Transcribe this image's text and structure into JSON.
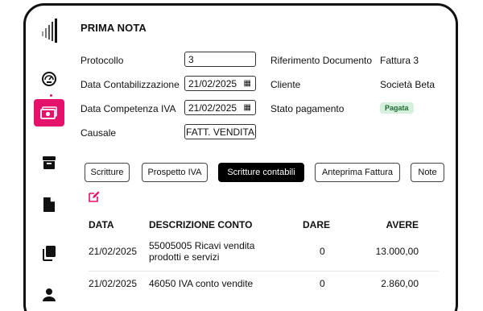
{
  "page": {
    "title": "PRIMA NOTA"
  },
  "sidebar": {
    "items": [
      {
        "icon": "dashboard-gauge-icon",
        "active": false
      },
      {
        "icon": "cash-icon",
        "active": true
      },
      {
        "icon": "archive-icon",
        "active": false
      },
      {
        "icon": "document-icon",
        "active": false
      },
      {
        "icon": "copy-icon",
        "active": false
      },
      {
        "icon": "user-icon",
        "active": false
      }
    ]
  },
  "form": {
    "protocollo": {
      "label": "Protocollo",
      "value": "3"
    },
    "data_contabilizzazione": {
      "label": "Data Contabilizzazione",
      "value": "21/02/2025"
    },
    "data_competenza_iva": {
      "label": "Data Competenza IVA",
      "value": "21/02/2025"
    },
    "causale": {
      "label": "Causale",
      "value": "FATT. VENDITA"
    },
    "riferimento_documento": {
      "label": "Riferimento Documento",
      "value": "Fattura 3"
    },
    "cliente": {
      "label": "Cliente",
      "value": "Società Beta"
    },
    "stato_pagamento": {
      "label": "Stato pagamento",
      "value": "Pagata"
    }
  },
  "tabs": [
    {
      "label": "Scritture",
      "active": false
    },
    {
      "label": "Prospetto IVA",
      "active": false
    },
    {
      "label": "Scritture contabili",
      "active": true
    },
    {
      "label": "Anteprima Fattura",
      "active": false
    },
    {
      "label": "Note",
      "active": false
    }
  ],
  "table": {
    "headers": {
      "data": "DATA",
      "descrizione": "DESCRIZIONE CONTO",
      "dare": "DARE",
      "avere": "AVERE"
    },
    "rows": [
      {
        "data": "21/02/2025",
        "descrizione": "55005005 Ricavi vendita prodotti e servizi",
        "dare": "0",
        "avere": "13.000,00"
      },
      {
        "data": "21/02/2025",
        "descrizione": "46050 IVA conto vendite",
        "dare": "0",
        "avere": "2.860,00"
      }
    ]
  },
  "colors": {
    "accent": "#e4126b",
    "badge_bg": "#d5f0dc",
    "badge_text": "#226b35"
  }
}
